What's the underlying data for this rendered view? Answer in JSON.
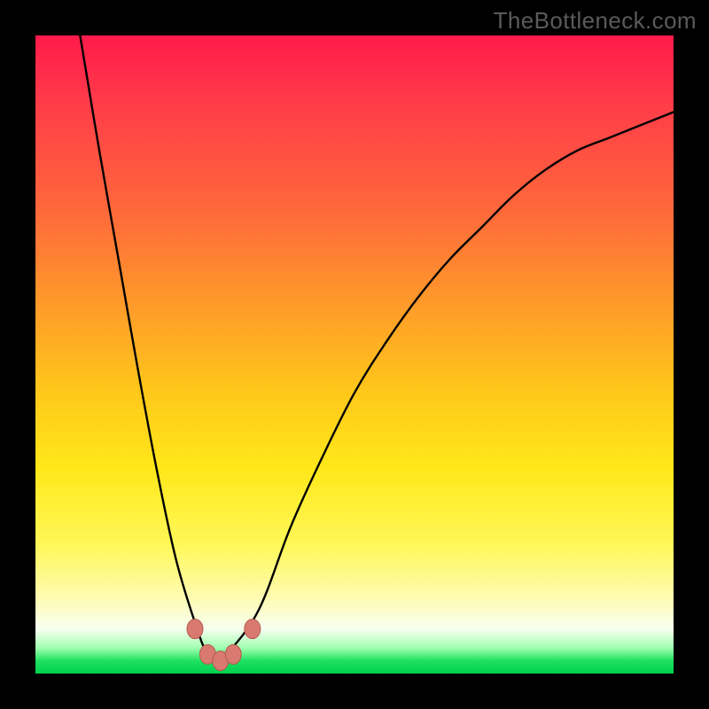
{
  "attribution": "TheBottleneck.com",
  "chart_data": {
    "type": "line",
    "title": "",
    "xlabel": "",
    "ylabel": "",
    "xlim": [
      0,
      100
    ],
    "ylim": [
      0,
      100
    ],
    "grid": false,
    "legend": false,
    "series": [
      {
        "name": "bottleneck-curve",
        "x": [
          7,
          10,
          13,
          16,
          19,
          22,
          25,
          27,
          29,
          30,
          35,
          40,
          45,
          50,
          55,
          60,
          65,
          70,
          75,
          80,
          85,
          90,
          95,
          100
        ],
        "y": [
          100,
          82,
          65,
          48,
          32,
          18,
          8,
          3,
          2,
          3,
          10,
          23,
          34,
          44,
          52,
          59,
          65,
          70,
          75,
          79,
          82,
          84,
          86,
          88
        ]
      }
    ],
    "markers": [
      {
        "name": "left-min-marker",
        "x": 25,
        "y": 7
      },
      {
        "name": "trough-marker-1",
        "x": 27,
        "y": 3
      },
      {
        "name": "trough-marker-2",
        "x": 29,
        "y": 2
      },
      {
        "name": "trough-marker-3",
        "x": 31,
        "y": 3
      },
      {
        "name": "right-min-marker",
        "x": 34,
        "y": 7
      }
    ],
    "colors": {
      "curve": "#000000",
      "marker_fill": "#d87a70",
      "marker_stroke": "#b85a50",
      "background_top": "#ff1a4a",
      "background_bottom": "#00d050"
    }
  }
}
